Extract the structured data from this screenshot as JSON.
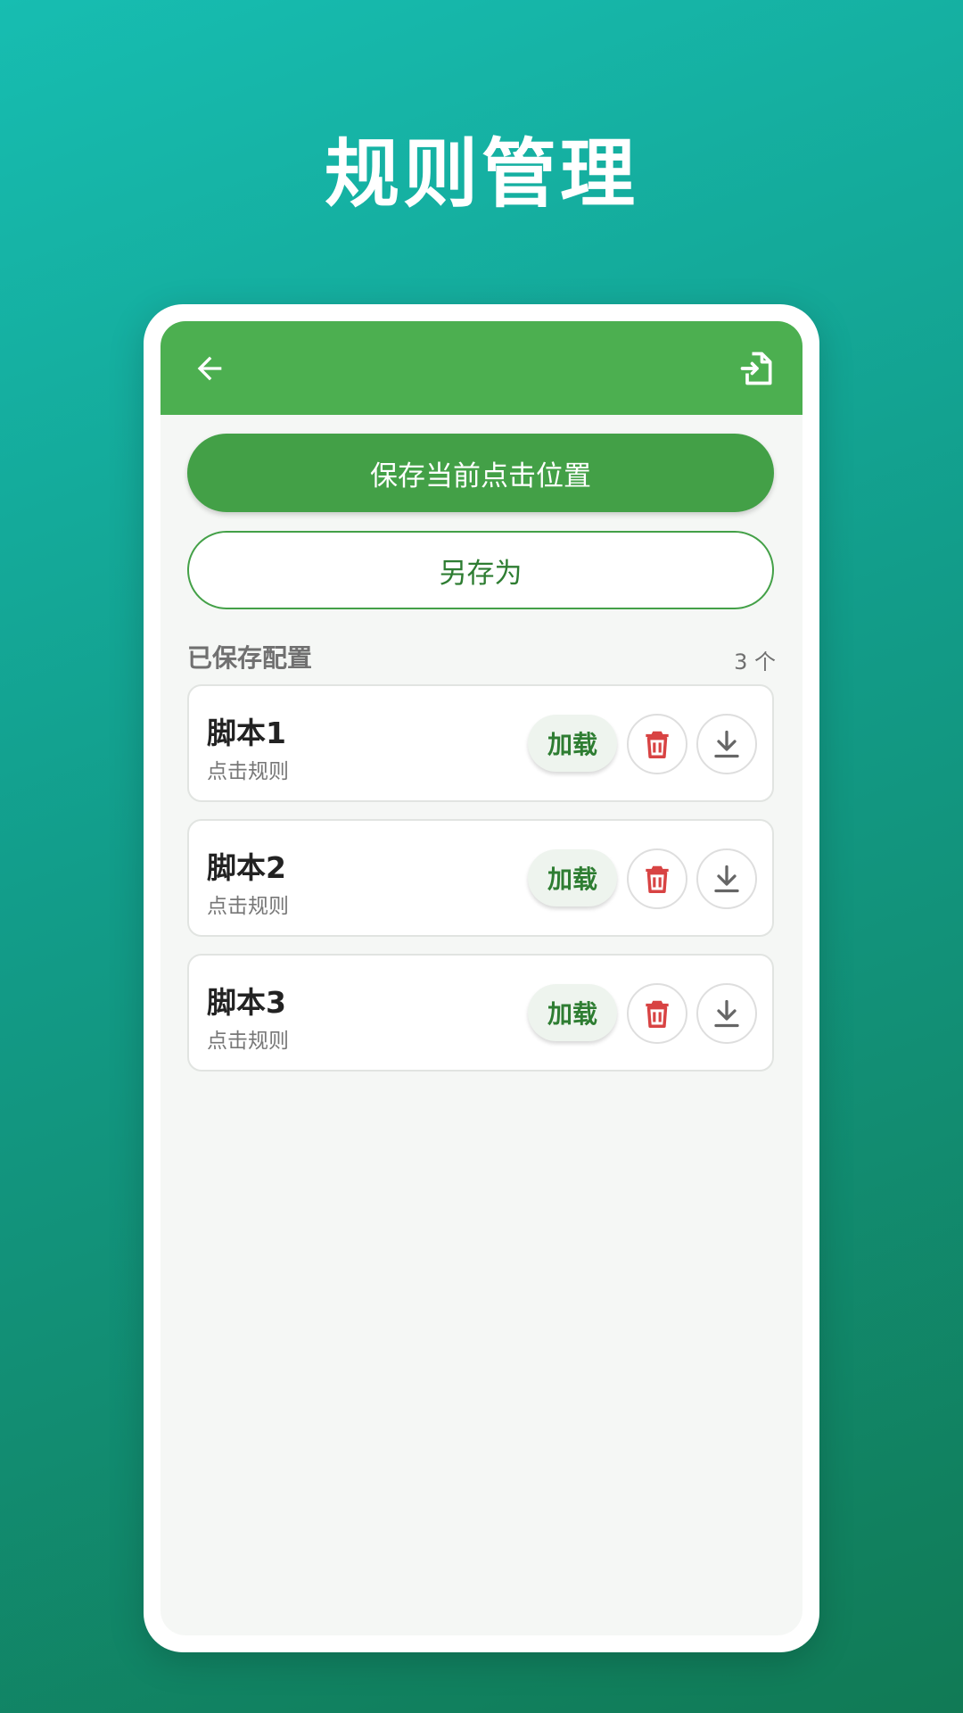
{
  "hero": {
    "title": "规则管理"
  },
  "appbar": {
    "back_icon": "arrow-left-icon",
    "import_icon": "file-import-icon",
    "bar_color": "#4caf50"
  },
  "actions": {
    "save_current": "保存当前点击位置",
    "save_as": "另存为"
  },
  "section": {
    "title": "已保存配置",
    "count": "3 个"
  },
  "configs": [
    {
      "name": "脚本1",
      "desc": "点击规则",
      "load": "加载"
    },
    {
      "name": "脚本2",
      "desc": "点击规则",
      "load": "加载"
    },
    {
      "name": "脚本3",
      "desc": "点击规则",
      "load": "加载"
    }
  ],
  "colors": {
    "accent": "#43a047",
    "danger": "#d84343",
    "muted": "#707070"
  }
}
